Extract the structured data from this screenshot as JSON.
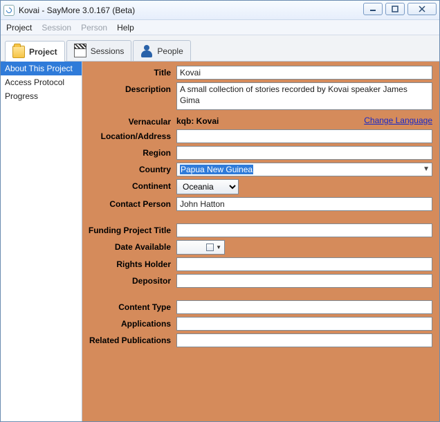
{
  "window": {
    "title": "Kovai - SayMore 3.0.167 (Beta)"
  },
  "menu": {
    "project": "Project",
    "session": "Session",
    "person": "Person",
    "help": "Help"
  },
  "tabs": {
    "project": "Project",
    "sessions": "Sessions",
    "people": "People"
  },
  "sidebar": {
    "items": [
      {
        "label": "About This Project"
      },
      {
        "label": "Access Protocol"
      },
      {
        "label": "Progress"
      }
    ]
  },
  "form": {
    "labels": {
      "title": "Title",
      "description": "Description",
      "vernacular": "Vernacular",
      "location": "Location/Address",
      "region": "Region",
      "country": "Country",
      "continent": "Continent",
      "contact": "Contact Person",
      "funding": "Funding Project Title",
      "date": "Date Available",
      "rights": "Rights Holder",
      "depositor": "Depositor",
      "contentType": "Content Type",
      "applications": "Applications",
      "related": "Related Publications"
    },
    "values": {
      "title": "Kovai",
      "description": "A small collection of stories recorded by Kovai speaker James Gima",
      "vernacular": "kqb: Kovai",
      "changeLang": "Change Language",
      "location": "",
      "region": "",
      "country": "Papua New Guinea",
      "continent": "Oceania",
      "contact": "John Hatton",
      "funding": "",
      "date": "",
      "rights": "",
      "depositor": "",
      "contentType": "",
      "applications": "",
      "related": ""
    }
  }
}
